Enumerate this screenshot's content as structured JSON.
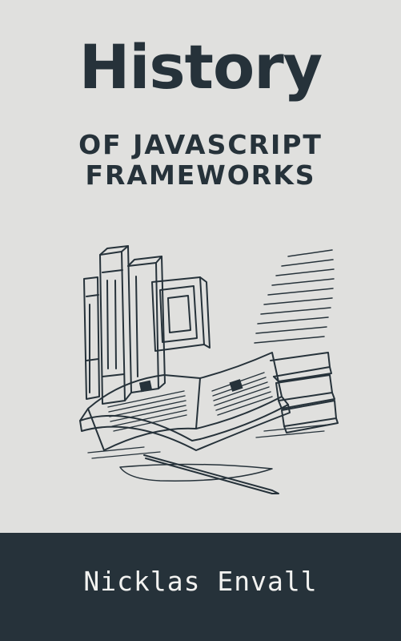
{
  "cover": {
    "title": "History",
    "subtitle_line1": "OF JAVASCRIPT",
    "subtitle_line2": "FRAMEWORKS",
    "author": "Nicklas Envall"
  },
  "colors": {
    "background": "#e0e0de",
    "ink": "#26323a",
    "footer_text": "#f2f2f0"
  },
  "illustration": {
    "icon": "books-and-open-book-illustration"
  }
}
